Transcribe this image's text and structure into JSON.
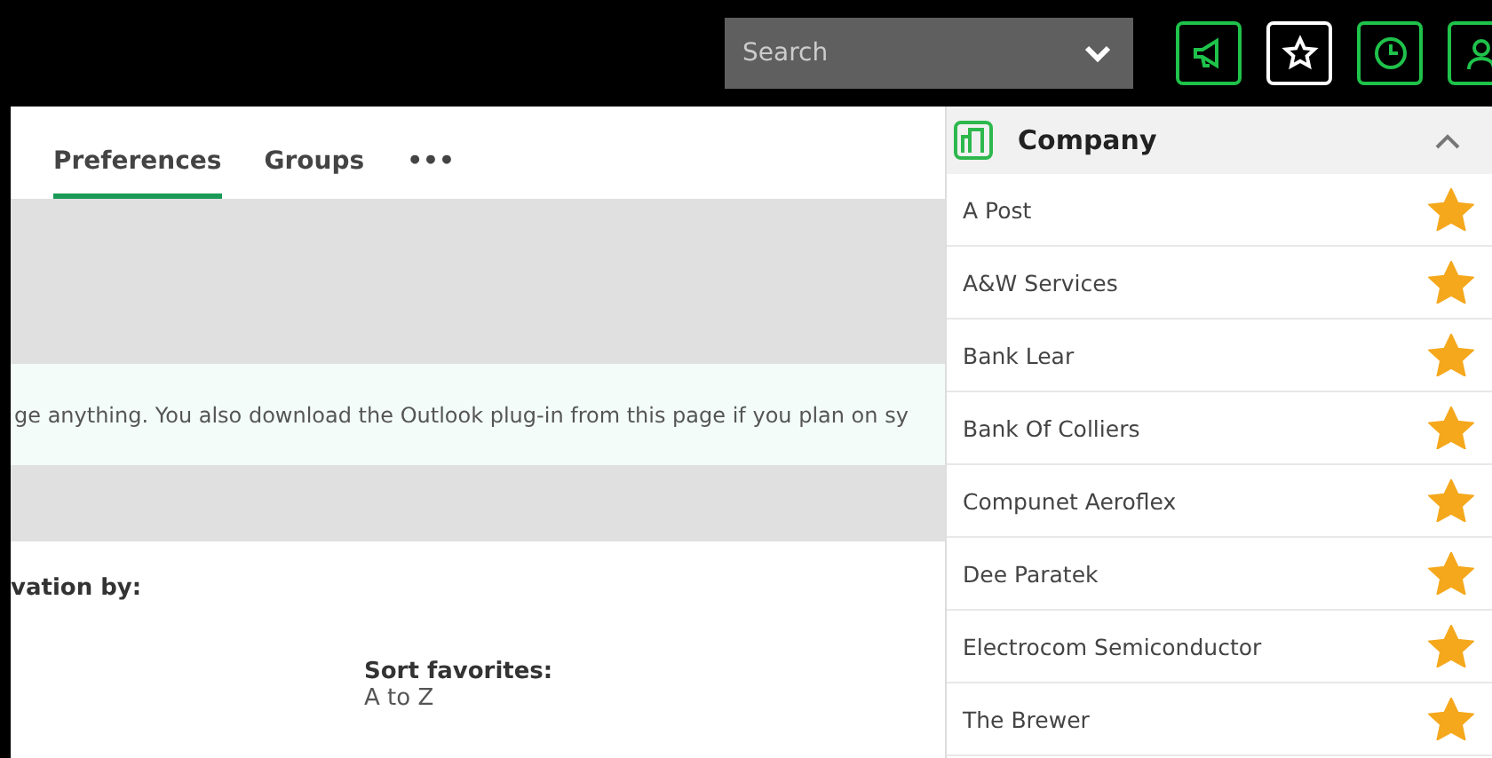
{
  "top_bar": {
    "search": {
      "placeholder": "Search"
    },
    "toolbar": [
      {
        "kind": "megaphone",
        "highlighted": true
      },
      {
        "kind": "star",
        "highlighted": false
      },
      {
        "kind": "clock",
        "highlighted": true
      },
      {
        "kind": "person",
        "highlighted": true
      }
    ]
  },
  "tabs": [
    {
      "label": "Preferences",
      "selected": true
    },
    {
      "label": "Groups",
      "selected": false
    },
    {
      "label": "•••",
      "selected": false
    }
  ],
  "notice": "ge anything. You also download the Outlook plug-in from this page if you plan on sy",
  "section_heading": "vation by:",
  "sort_favorites": {
    "label": "Sort favorites:",
    "value": "A to Z"
  },
  "favorites_panel": {
    "title": "Company",
    "expanded": true,
    "items": [
      {
        "name": "A Post",
        "favorite": true
      },
      {
        "name": "A&W Services",
        "favorite": true
      },
      {
        "name": "Bank Lear",
        "favorite": true
      },
      {
        "name": "Bank Of Colliers",
        "favorite": true
      },
      {
        "name": "Compunet Aeroflex",
        "favorite": true
      },
      {
        "name": "Dee Paratek",
        "favorite": true
      },
      {
        "name": "Electrocom Semiconductor",
        "favorite": true
      },
      {
        "name": "The Brewer",
        "favorite": true
      }
    ]
  }
}
